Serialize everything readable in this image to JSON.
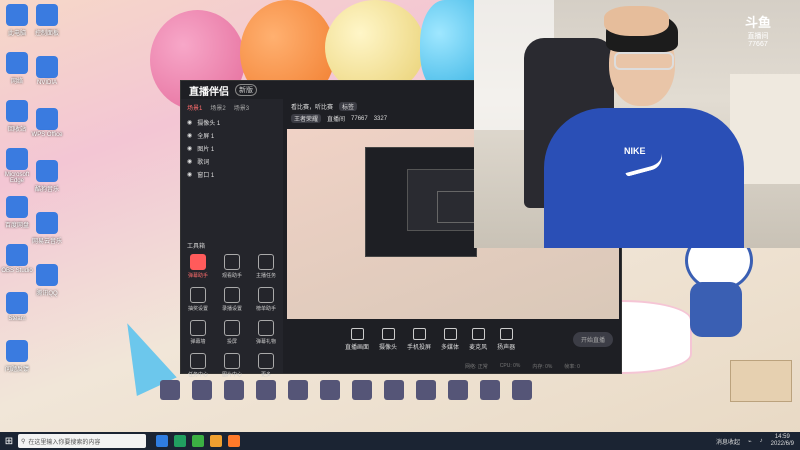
{
  "desktop": {
    "icons_left": [
      {
        "label": "此电脑",
        "icon": "computer-icon"
      },
      {
        "label": "网络",
        "icon": "network-icon"
      },
      {
        "label": "回收站",
        "icon": "recycle-bin-icon"
      },
      {
        "label": "Microsoft Edge",
        "icon": "edge-icon"
      },
      {
        "label": "百度网盘",
        "icon": "baidu-netdisk-icon"
      },
      {
        "label": "OBS Studio",
        "icon": "obs-icon"
      },
      {
        "label": "Steam",
        "icon": "steam-icon"
      },
      {
        "label": "问题反馈",
        "icon": "feedback-icon"
      }
    ],
    "icons_col2": [
      {
        "label": "控制面板",
        "icon": "control-panel-icon"
      },
      {
        "label": "NVIDIA",
        "icon": "nvidia-icon"
      },
      {
        "label": "WPS Office",
        "icon": "wps-icon"
      },
      {
        "label": "酷狗音乐",
        "icon": "music-icon"
      },
      {
        "label": "网易云音乐",
        "icon": "netease-icon"
      },
      {
        "label": "腾讯QQ",
        "icon": "qq-icon"
      }
    ]
  },
  "app": {
    "title": "直播伴侣",
    "version_badge": "新版",
    "tabs": [
      "场景1",
      "场景2",
      "场景3"
    ],
    "scenes": [
      "摄像头 1",
      "全屏 1",
      "图片 1",
      "歌词",
      "窗口 1"
    ],
    "tools_title": "工具箱",
    "tools": [
      {
        "label": "弹幕助手",
        "hot": true
      },
      {
        "label": "观看助手",
        "hot": false
      },
      {
        "label": "主播任务",
        "hot": false
      },
      {
        "label": "抽奖设置",
        "hot": false
      },
      {
        "label": "录播设置",
        "hot": false
      },
      {
        "label": "榜单助手",
        "hot": false
      },
      {
        "label": "弹幕墙",
        "hot": false
      },
      {
        "label": "投屏",
        "hot": false
      },
      {
        "label": "弹幕礼物",
        "hot": false
      },
      {
        "label": "任务中心",
        "hot": false
      },
      {
        "label": "图片中心",
        "hot": false
      },
      {
        "label": "更多",
        "hot": false
      }
    ],
    "topbar": {
      "room_title": "看比赛，听比赛",
      "tag": "标签",
      "category": "王者荣耀",
      "info": "直播间",
      "fans": "77667",
      "online": "3327"
    },
    "bottom_buttons": [
      {
        "label": "直播画面",
        "icon": "screen-icon"
      },
      {
        "label": "摄像头",
        "icon": "camera-icon"
      },
      {
        "label": "手机投屏",
        "icon": "phone-icon"
      },
      {
        "label": "多媒体",
        "icon": "media-icon"
      },
      {
        "label": "麦克风",
        "icon": "mic-icon"
      },
      {
        "label": "扬声器",
        "icon": "speaker-icon"
      }
    ],
    "start_live": "开始直播",
    "status": [
      "网络: 正常",
      "CPU: 0%",
      "内存: 0%",
      "帧率: 0"
    ]
  },
  "camera": {
    "overlay_brand": "斗鱼",
    "overlay_sub": "直播间",
    "overlay_room": "77667",
    "shirt_logo": "NIKE"
  },
  "taskbar": {
    "search_placeholder": "在这里输入你要搜索的内容",
    "tray_text": "消息收起",
    "time": "14:59",
    "date": "2022/6/9"
  }
}
